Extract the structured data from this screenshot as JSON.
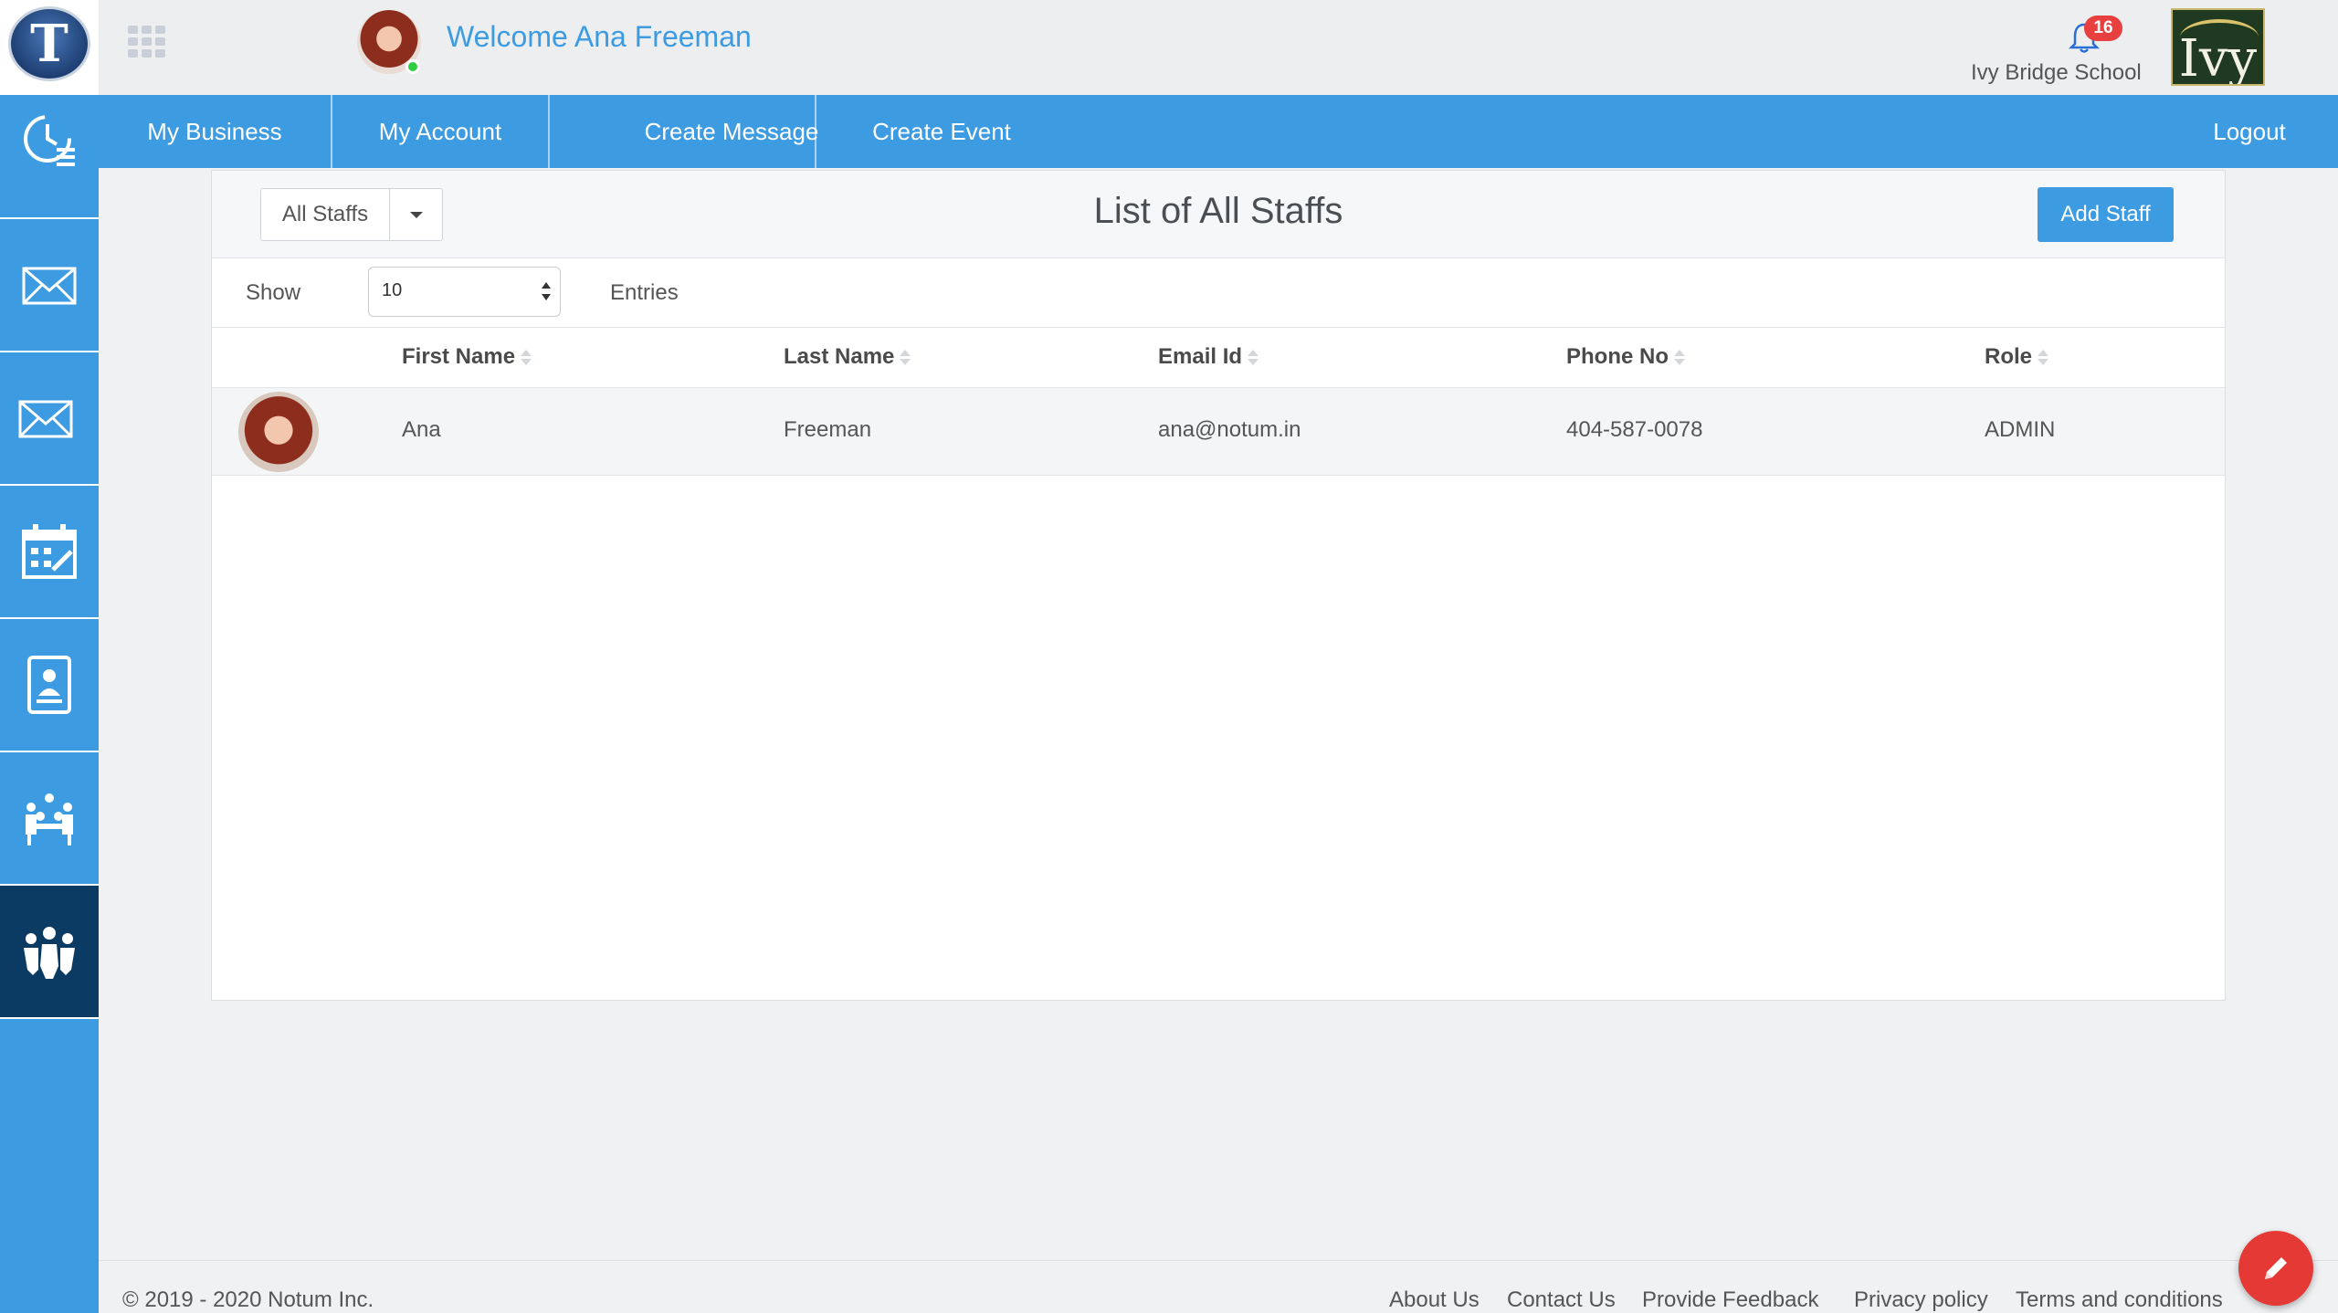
{
  "header": {
    "welcome": "Welcome Ana Freeman",
    "notification_count": "16",
    "school_name": "Ivy Bridge School",
    "school_logo_text": "Ivy",
    "app_logo_letter": "T"
  },
  "nav": {
    "items": [
      {
        "label": "My Business"
      },
      {
        "label": "My Account"
      },
      {
        "label": "Create Message"
      },
      {
        "label": "Create Event"
      }
    ],
    "logout": "Logout"
  },
  "sidebar": {
    "items": [
      {
        "icon": "dashboard-clock-icon"
      },
      {
        "icon": "envelope-icon"
      },
      {
        "icon": "envelope-icon"
      },
      {
        "icon": "calendar-edit-icon"
      },
      {
        "icon": "contact-tablet-icon"
      },
      {
        "icon": "meeting-group-icon"
      },
      {
        "icon": "staff-group-icon",
        "active": true
      }
    ]
  },
  "main": {
    "filter_label": "All Staffs",
    "title": "List of All Staffs",
    "add_button": "Add Staff",
    "show_label": "Show",
    "page_size": "10",
    "entries_label": "Entries",
    "columns": [
      "First Name",
      "Last Name",
      "Email Id",
      "Phone No",
      "Role"
    ],
    "rows": [
      {
        "first_name": "Ana",
        "last_name": "Freeman",
        "email": "ana@notum.in",
        "phone": "404-587-0078",
        "role": "ADMIN"
      }
    ]
  },
  "footer": {
    "copyright": "© 2019 - 2020 Notum Inc.",
    "links": [
      "About Us",
      "Contact Us",
      "Provide Feedback",
      "Privacy policy",
      "Terms and conditions"
    ]
  },
  "colors": {
    "primary": "#3d9be2",
    "sidebar_active": "#0b3a63",
    "badge": "#e8403f",
    "fab": "#e53935",
    "online": "#2ecc40"
  }
}
